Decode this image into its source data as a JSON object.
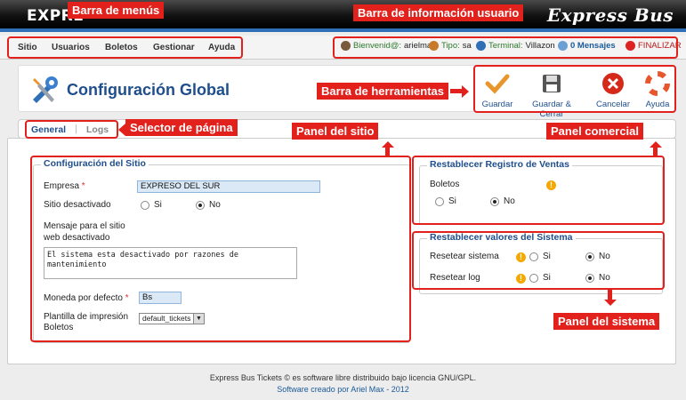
{
  "header": {
    "brand_left": "EXPRE",
    "brand_right": "Express Bus"
  },
  "menu": {
    "items": [
      "Sitio",
      "Usuarios",
      "Boletos",
      "Gestionar",
      "Ayuda"
    ]
  },
  "userbar": {
    "welcome": "Bienvenid@:",
    "user": "arielmax",
    "tipo_label": "Tipo:",
    "tipo_value": "sa",
    "terminal_label": "Terminal:",
    "terminal_value": "Villazon",
    "messages": "0 Mensajes",
    "logout": "FINALIZAR"
  },
  "page": {
    "title": "Configuración Global"
  },
  "toolbar": {
    "save": "Guardar",
    "save_close": "Guardar & Cerrar",
    "cancel": "Cancelar",
    "help": "Ayuda"
  },
  "tabs": [
    "General",
    "Logs"
  ],
  "site_config": {
    "legend": "Configuración del Sitio",
    "empresa_label": "Empresa",
    "empresa_value": "EXPRESO DEL SUR",
    "desactivado_label": "Sitio desactivado",
    "si": "Si",
    "no": "No",
    "mensaje_label_1": "Mensaje para el sitio",
    "mensaje_label_2": "web desactivado",
    "mensaje_line1": "El sistema esta desactivado por razones de",
    "mensaje_line2": "mantenimiento",
    "moneda_label": "Moneda por defecto",
    "moneda_value": "Bs",
    "plantilla_label_1": "Plantilla de impresión",
    "plantilla_label_2": "Boletos",
    "plantilla_value": "default_tickets",
    "required_mark": "*"
  },
  "ventas": {
    "legend": "Restablecer Registro de Ventas",
    "boletos_label": "Boletos",
    "si": "Si",
    "no": "No"
  },
  "sistema": {
    "legend": "Restablecer valores del Sistema",
    "resetear_sistema": "Resetear sistema",
    "resetear_log": "Resetear log",
    "si": "Si",
    "no": "No"
  },
  "annotations": {
    "menus": "Barra de menús",
    "userinfo": "Barra de información usuario",
    "herramientas": "Barra de herramientas",
    "selector": "Selector de página",
    "panel_sitio": "Panel del sitio",
    "panel_comercial": "Panel comercial",
    "panel_sistema": "Panel del sistema"
  },
  "footer": {
    "line1": "Express Bus Tickets © es software libre distribuido bajo licencia GNU/GPL.",
    "line2": "Software creado por Ariel Max - 2012"
  },
  "colors": {
    "accent": "#1f4e8c",
    "annotation": "#e2201c",
    "header_strip": "#2f6fb5"
  }
}
